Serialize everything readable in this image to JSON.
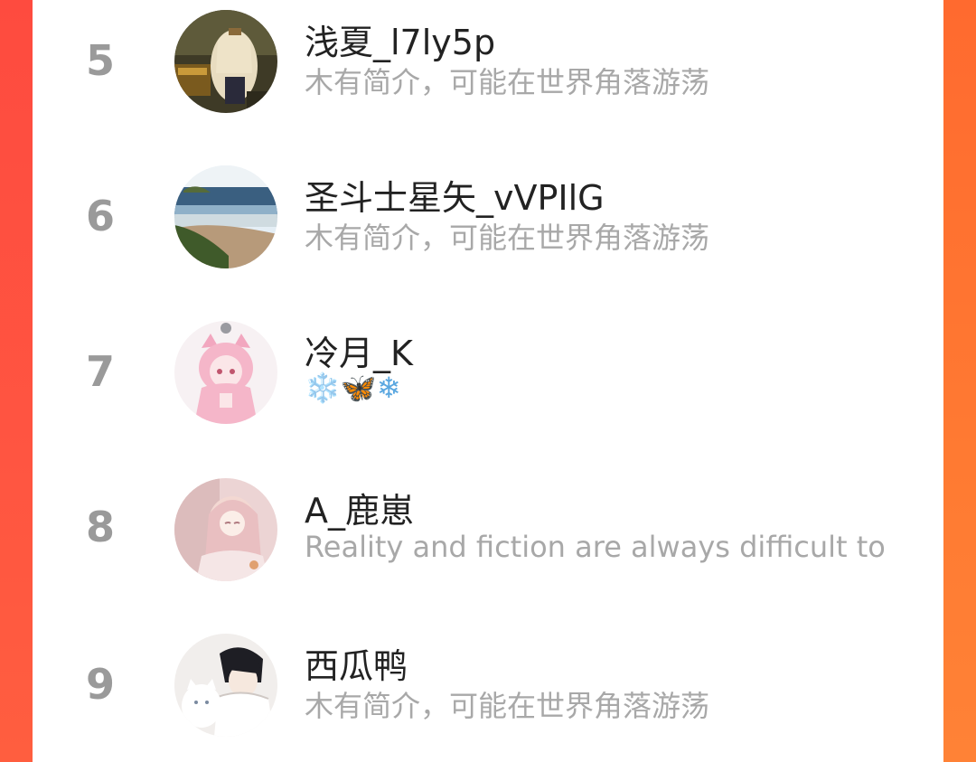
{
  "users": [
    {
      "rank": "5",
      "name": "浅夏_l7ly5p",
      "bio": "木有简介，可能在世界角落游荡",
      "avatar_icon": "anime-girl-avatar"
    },
    {
      "rank": "6",
      "name": "圣斗士星矢_vVPIlG",
      "bio": "木有简介，可能在世界角落游荡",
      "avatar_icon": "seaside-avatar"
    },
    {
      "rank": "7",
      "name": "冷月_K",
      "bio": "❄️🦋❄",
      "avatar_icon": "pink-hood-avatar"
    },
    {
      "rank": "8",
      "name": "A_鹿崽",
      "bio": "Reality and fiction are always difficult to",
      "avatar_icon": "pastel-girl-avatar"
    },
    {
      "rank": "9",
      "name": "西瓜鸭",
      "bio": "木有简介，可能在世界角落游荡",
      "avatar_icon": "boy-with-cat-avatar"
    }
  ]
}
